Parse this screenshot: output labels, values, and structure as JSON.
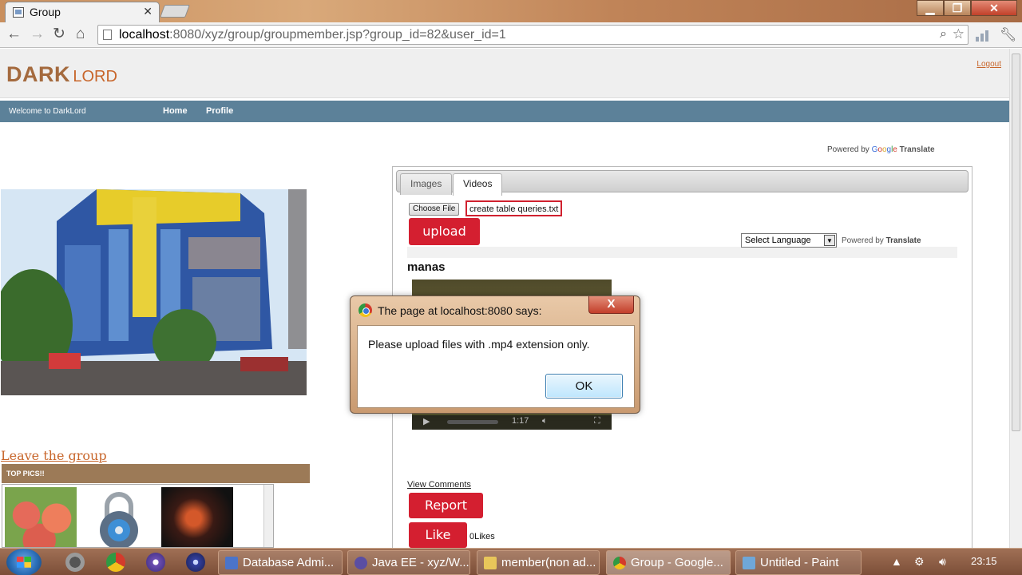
{
  "browser": {
    "tab_title": "Group",
    "tab_close": "✕",
    "url_host": "localhost",
    "url_rest": ":8080/xyz/group/groupmember.jsp?group_id=82&user_id=1",
    "window_buttons": {
      "minimize": "▁",
      "restore": "❐",
      "close": "✕"
    },
    "nav_icons": {
      "back": "←",
      "forward": "→",
      "reload": "↻",
      "home": "⌂"
    }
  },
  "header": {
    "logo_main": "DARK",
    "logo_sub": "LORD",
    "logout": "Logout"
  },
  "navbar": {
    "welcome": "Welcome to DarkLord",
    "links": [
      "Home",
      "Profile"
    ]
  },
  "translate": {
    "powered_by": "Powered by",
    "google": [
      "G",
      "o",
      "o",
      "g",
      "l",
      "e"
    ],
    "translate": "Translate",
    "select_language": "Select Language"
  },
  "left": {
    "leave_group": "Leave the group",
    "top_pics": "TOP PICS!!"
  },
  "panel": {
    "tabs": [
      "Images",
      "Videos"
    ],
    "active_tab": "Videos",
    "choose_file": "Choose File",
    "file_name": "create table queries.txt",
    "upload": "upload",
    "member_name": "manas",
    "video_time": "1:17",
    "view_comments": "View Comments",
    "report": "Report",
    "like": "Like",
    "likes": "0Likes"
  },
  "dialog": {
    "title": "The page at localhost:8080 says:",
    "message": "Please upload files with .mp4 extension only.",
    "ok": "OK",
    "close": "X"
  },
  "taskbar": {
    "tasks": [
      {
        "label": "Database Admi..."
      },
      {
        "label": "Java EE - xyz/W..."
      },
      {
        "label": "member(non ad..."
      },
      {
        "label": "Group - Google..."
      },
      {
        "label": "Untitled - Paint"
      }
    ],
    "active_task": "Group - Google...",
    "clock": "23:15"
  },
  "colors": {
    "accent_red": "#d41f30",
    "navbar": "#5c8199",
    "logo": "#a46a3e",
    "link_orange": "#c8662b"
  }
}
